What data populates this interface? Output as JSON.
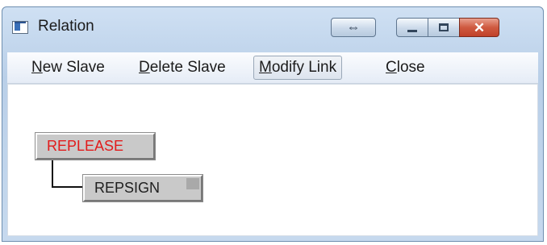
{
  "window": {
    "title": "Relation",
    "extra_button_glyph": "⇔",
    "close_glyph": "✕"
  },
  "menu": {
    "items": [
      {
        "label": "New Slave",
        "access_key": "N",
        "rest": "ew Slave"
      },
      {
        "label": "Delete Slave",
        "access_key": "D",
        "rest": "elete Slave"
      },
      {
        "label": "Modify Link",
        "access_key": "M",
        "rest": "odify Link",
        "pressed": true
      },
      {
        "label": "Close",
        "access_key": "C",
        "rest": "lose"
      }
    ]
  },
  "tree": {
    "master": {
      "label": "REPLEASE",
      "color": "#e21b1b"
    },
    "slave": {
      "label": "REPSIGN",
      "color": "#202020"
    }
  },
  "icons": {
    "app": "app-window-icon",
    "extra": "double-arrow-icon",
    "minimize": "minimize-icon",
    "maximize": "maximize-icon",
    "close": "close-icon"
  }
}
